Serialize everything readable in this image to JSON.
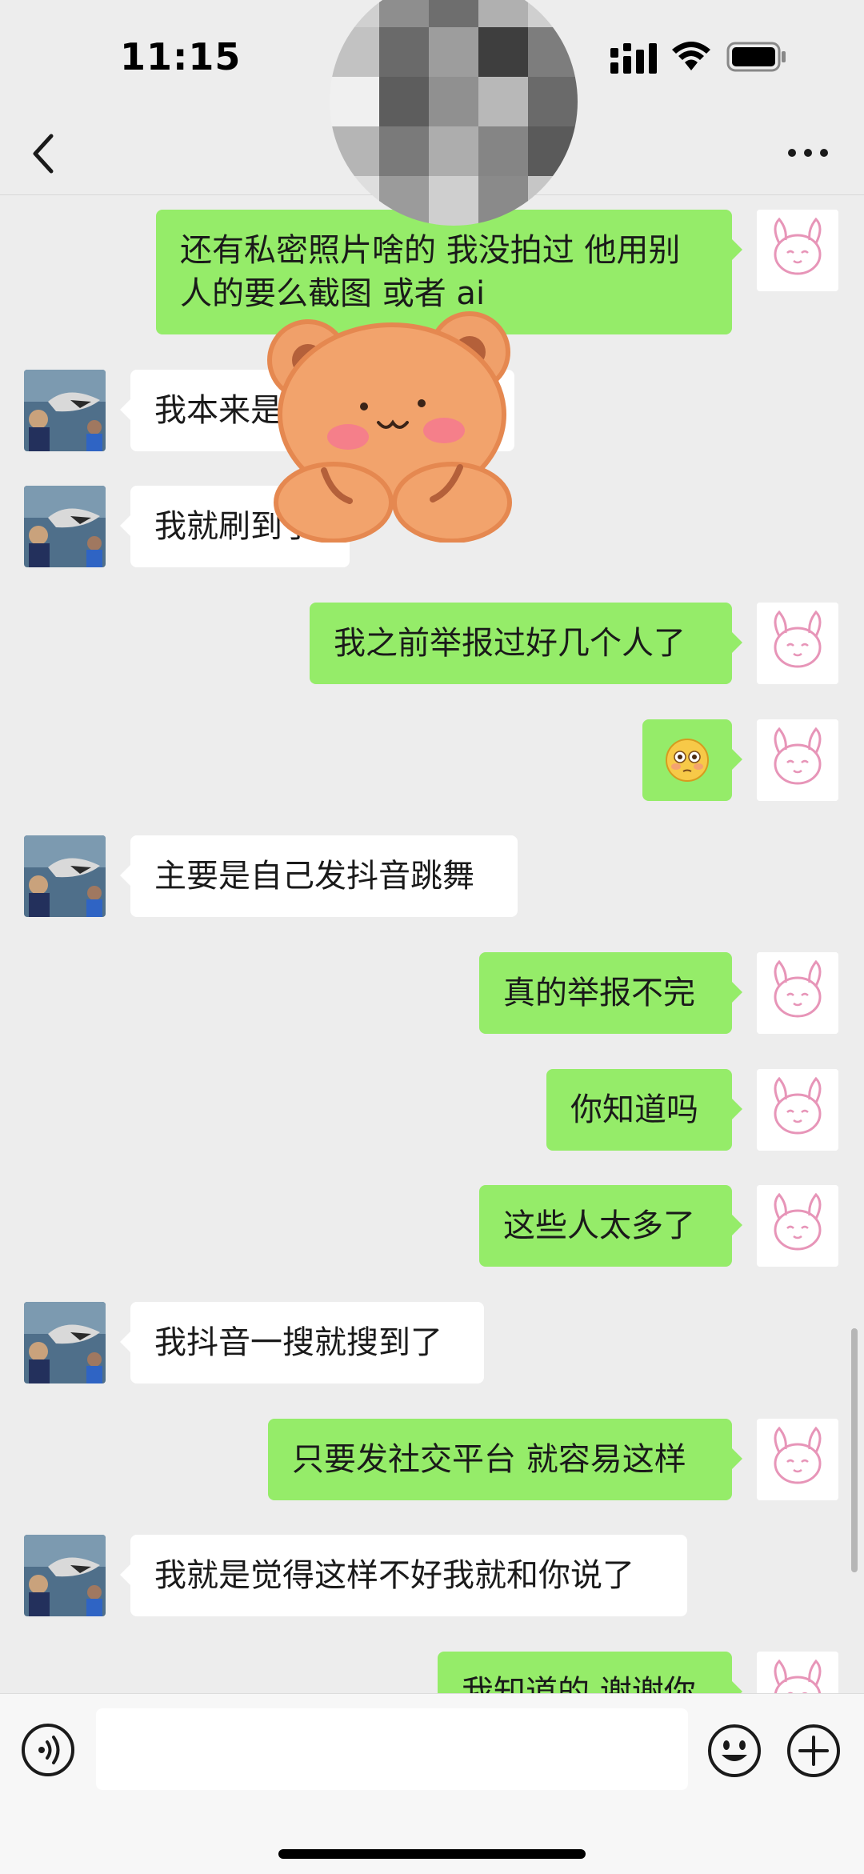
{
  "status_bar": {
    "time": "11:15",
    "icons": [
      "signal-icon",
      "wifi-icon",
      "battery-icon"
    ]
  },
  "header": {
    "back_icon": "chevron-left-icon",
    "more_icon": "more-dots-icon"
  },
  "colors": {
    "self_bubble": "#95ec69",
    "other_bubble": "#ffffff",
    "background": "#ededed"
  },
  "messages": [
    {
      "from": "self",
      "text": "还有私密照片啥的 我没拍过 他用别人的要么截图 或者 ai"
    },
    {
      "from": "other",
      "text": "我本来是在看前女友的"
    },
    {
      "from": "other",
      "text": "我就刷到了"
    },
    {
      "from": "self",
      "text": "我之前举报过好几个人了"
    },
    {
      "from": "self",
      "text": "",
      "emoji": "flushed-face-emoji"
    },
    {
      "from": "other",
      "text": "主要是自己发抖音跳舞"
    },
    {
      "from": "self",
      "text": "真的举报不完"
    },
    {
      "from": "self",
      "text": "你知道吗"
    },
    {
      "from": "self",
      "text": "这些人太多了"
    },
    {
      "from": "other",
      "text": "我抖音一搜就搜到了"
    },
    {
      "from": "self",
      "text": "只要发社交平台 就容易这样"
    },
    {
      "from": "other",
      "text": "我就是觉得这样不好我就和你说了"
    },
    {
      "from": "self",
      "text": "我知道的 谢谢你"
    }
  ],
  "input": {
    "value": "",
    "placeholder": ""
  },
  "bottom_icons": [
    "voice-icon",
    "emoji-icon",
    "plus-icon"
  ]
}
